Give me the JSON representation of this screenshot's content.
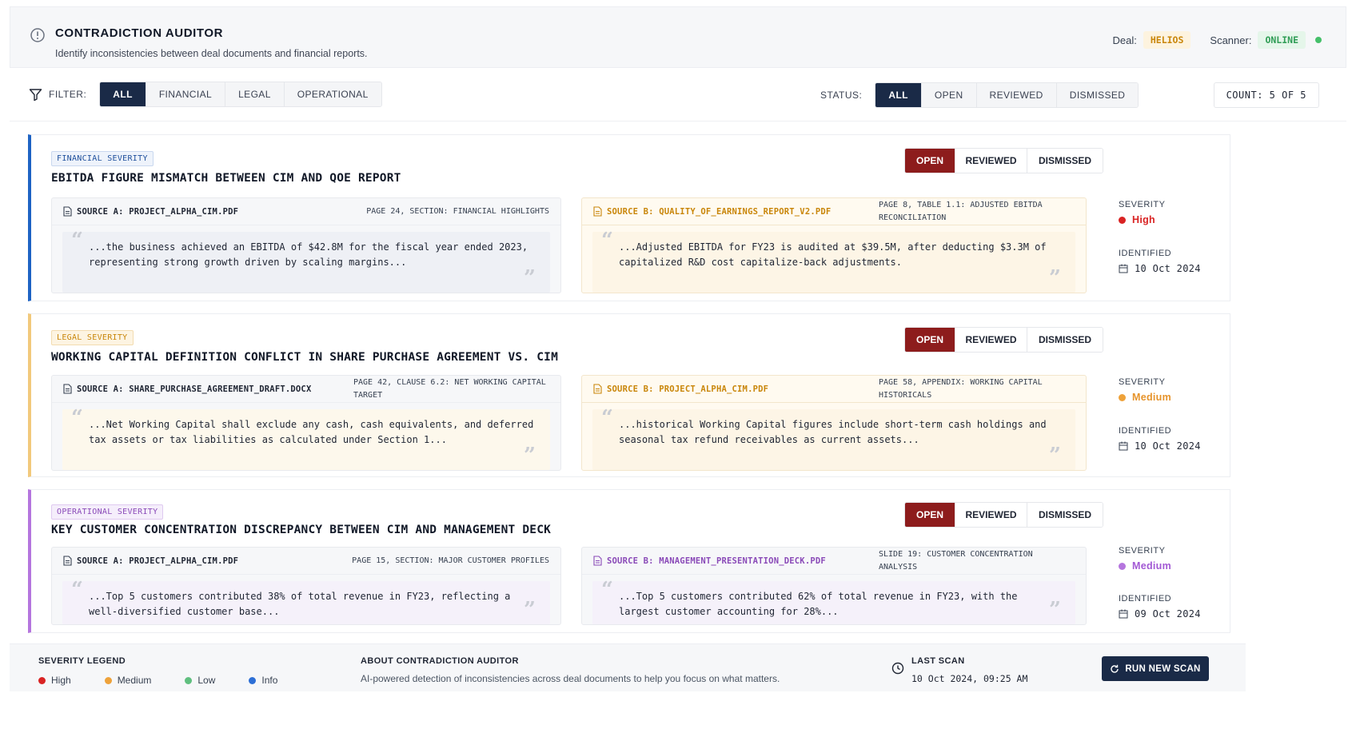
{
  "header": {
    "title": "CONTRADICTION AUDITOR",
    "subtitle": "Identify inconsistencies between deal documents and financial reports.",
    "deal_label": "Deal:",
    "deal_value": "HELIOS",
    "scanner_label": "Scanner:",
    "scanner_value": "ONLINE"
  },
  "filters": {
    "filter_label": "FILTER:",
    "categories": [
      "ALL",
      "FINANCIAL",
      "LEGAL",
      "OPERATIONAL"
    ],
    "active_category": "ALL",
    "status_label": "STATUS:",
    "statuses": [
      "ALL",
      "OPEN",
      "REVIEWED",
      "DISMISSED"
    ],
    "active_status": "ALL",
    "count": "COUNT: 5 OF 5"
  },
  "card_actions": {
    "open": "OPEN",
    "reviewed": "REVIEWED",
    "dismissed": "DISMISSED"
  },
  "meta_labels": {
    "severity": "SEVERITY",
    "identified": "IDENTIFIED"
  },
  "cards": [
    {
      "tag": "FINANCIAL SEVERITY",
      "title": "EBITDA FIGURE MISMATCH BETWEEN CIM AND QOE REPORT",
      "source_a": {
        "name": "SOURCE A: PROJECT_ALPHA_CIM.PDF",
        "ref": "PAGE 24, SECTION: FINANCIAL HIGHLIGHTS",
        "quote": "...the business achieved an EBITDA of $42.8M for the fiscal year ended 2023, representing strong growth driven by scaling margins..."
      },
      "source_b": {
        "name": "SOURCE B: QUALITY_OF_EARNINGS_REPORT_V2.PDF",
        "ref": "PAGE 8, TABLE 1.1: ADJUSTED EBITDA RECONCILIATION",
        "quote": "...Adjusted EBITDA for FY23 is audited at $39.5M, after deducting $3.3M of capitalized R&D cost capitalize-back adjustments."
      },
      "severity": "High",
      "identified": "10 Oct 2024"
    },
    {
      "tag": "LEGAL SEVERITY",
      "title": "WORKING CAPITAL DEFINITION CONFLICT IN SHARE PURCHASE AGREEMENT VS. CIM",
      "source_a": {
        "name": "SOURCE A: SHARE_PURCHASE_AGREEMENT_DRAFT.DOCX",
        "ref": "PAGE 42, CLAUSE 6.2: NET WORKING CAPITAL TARGET",
        "quote": "...Net Working Capital shall exclude any cash, cash equivalents, and deferred tax assets or tax liabilities as calculated under Section 1..."
      },
      "source_b": {
        "name": "SOURCE B: PROJECT_ALPHA_CIM.PDF",
        "ref": "PAGE 58, APPENDIX: WORKING CAPITAL HISTORICALS",
        "quote": "...historical Working Capital figures include short-term cash holdings and seasonal tax refund receivables as current assets..."
      },
      "severity": "Medium",
      "identified": "10 Oct 2024"
    },
    {
      "tag": "OPERATIONAL SEVERITY",
      "title": "KEY CUSTOMER CONCENTRATION DISCREPANCY BETWEEN CIM AND MANAGEMENT DECK",
      "source_a": {
        "name": "SOURCE A: PROJECT_ALPHA_CIM.PDF",
        "ref": "PAGE 15, SECTION: MAJOR CUSTOMER PROFILES",
        "quote": "...Top 5 customers contributed 38% of total revenue in FY23, reflecting a well-diversified customer base..."
      },
      "source_b": {
        "name": "SOURCE B: MANAGEMENT_PRESENTATION_DECK.PDF",
        "ref": "SLIDE 19: CUSTOMER CONCENTRATION ANALYSIS",
        "quote": "...Top 5 customers contributed 62% of total revenue in FY23, with the largest customer accounting for 28%..."
      },
      "severity": "Medium",
      "identified": "09 Oct 2024"
    }
  ],
  "footer": {
    "legend_title": "SEVERITY LEGEND",
    "legend": [
      "High",
      "Medium",
      "Low",
      "Info"
    ],
    "about_title": "ABOUT CONTRADICTION AUDITOR",
    "about_text": "AI-powered detection of inconsistencies across deal documents to help you focus on what matters.",
    "last_scan_label": "LAST SCAN",
    "last_scan_value": "10 Oct 2024, 09:25 AM",
    "run_button": "RUN NEW SCAN"
  },
  "colors": {
    "navy": "#1a2a47",
    "open_red": "#8d1c1c",
    "high": "#d92323",
    "medium": "#eea23a",
    "low": "#5fbf7f",
    "info": "#2d6fd6",
    "financial": "#1e63c4",
    "legal": "#f2c97c",
    "operational": "#b575de"
  }
}
